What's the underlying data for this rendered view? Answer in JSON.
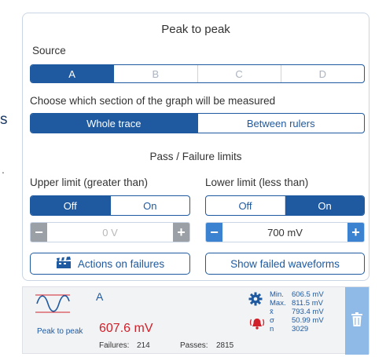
{
  "stray": {
    "letter": "s",
    "dot": "."
  },
  "panel": {
    "title": "Peak to peak",
    "source": {
      "label": "Source",
      "options": [
        "A",
        "B",
        "C",
        "D"
      ],
      "selected": "A"
    },
    "section": {
      "label": "Choose which section of the graph will be measured",
      "options": [
        "Whole trace",
        "Between rulers"
      ],
      "selected": "Whole trace"
    },
    "limits": {
      "title": "Pass / Failure limits",
      "upper": {
        "label": "Upper limit (greater than)",
        "off": "Off",
        "on": "On",
        "selected": "Off",
        "value": "0 V"
      },
      "lower": {
        "label": "Lower limit (less than)",
        "off": "Off",
        "on": "On",
        "selected": "On",
        "value": "700 mV"
      }
    },
    "actions_button": "Actions on failures",
    "show_failed_button": "Show failed waveforms"
  },
  "measurement": {
    "channel": "A",
    "type_label": "Peak to peak",
    "value": "607.6 mV",
    "failures_label": "Failures:",
    "failures": "214",
    "passes_label": "Passes:",
    "passes": "2815",
    "stats": {
      "min_label": "Min.",
      "min": "606.5 mV",
      "max_label": "Max.",
      "max": "811.5 mV",
      "mean_label": "x̄",
      "mean": "793.4 mV",
      "sigma_label": "σ",
      "sigma": "50.99 mV",
      "n_label": "n",
      "n": "3029"
    }
  },
  "colors": {
    "accent": "#1f5aa0",
    "stepper_active": "#3b83d1",
    "stepper_disabled": "#9aa0a6",
    "alert_red": "#d0202a",
    "trash_bg": "#8fb9e6"
  }
}
